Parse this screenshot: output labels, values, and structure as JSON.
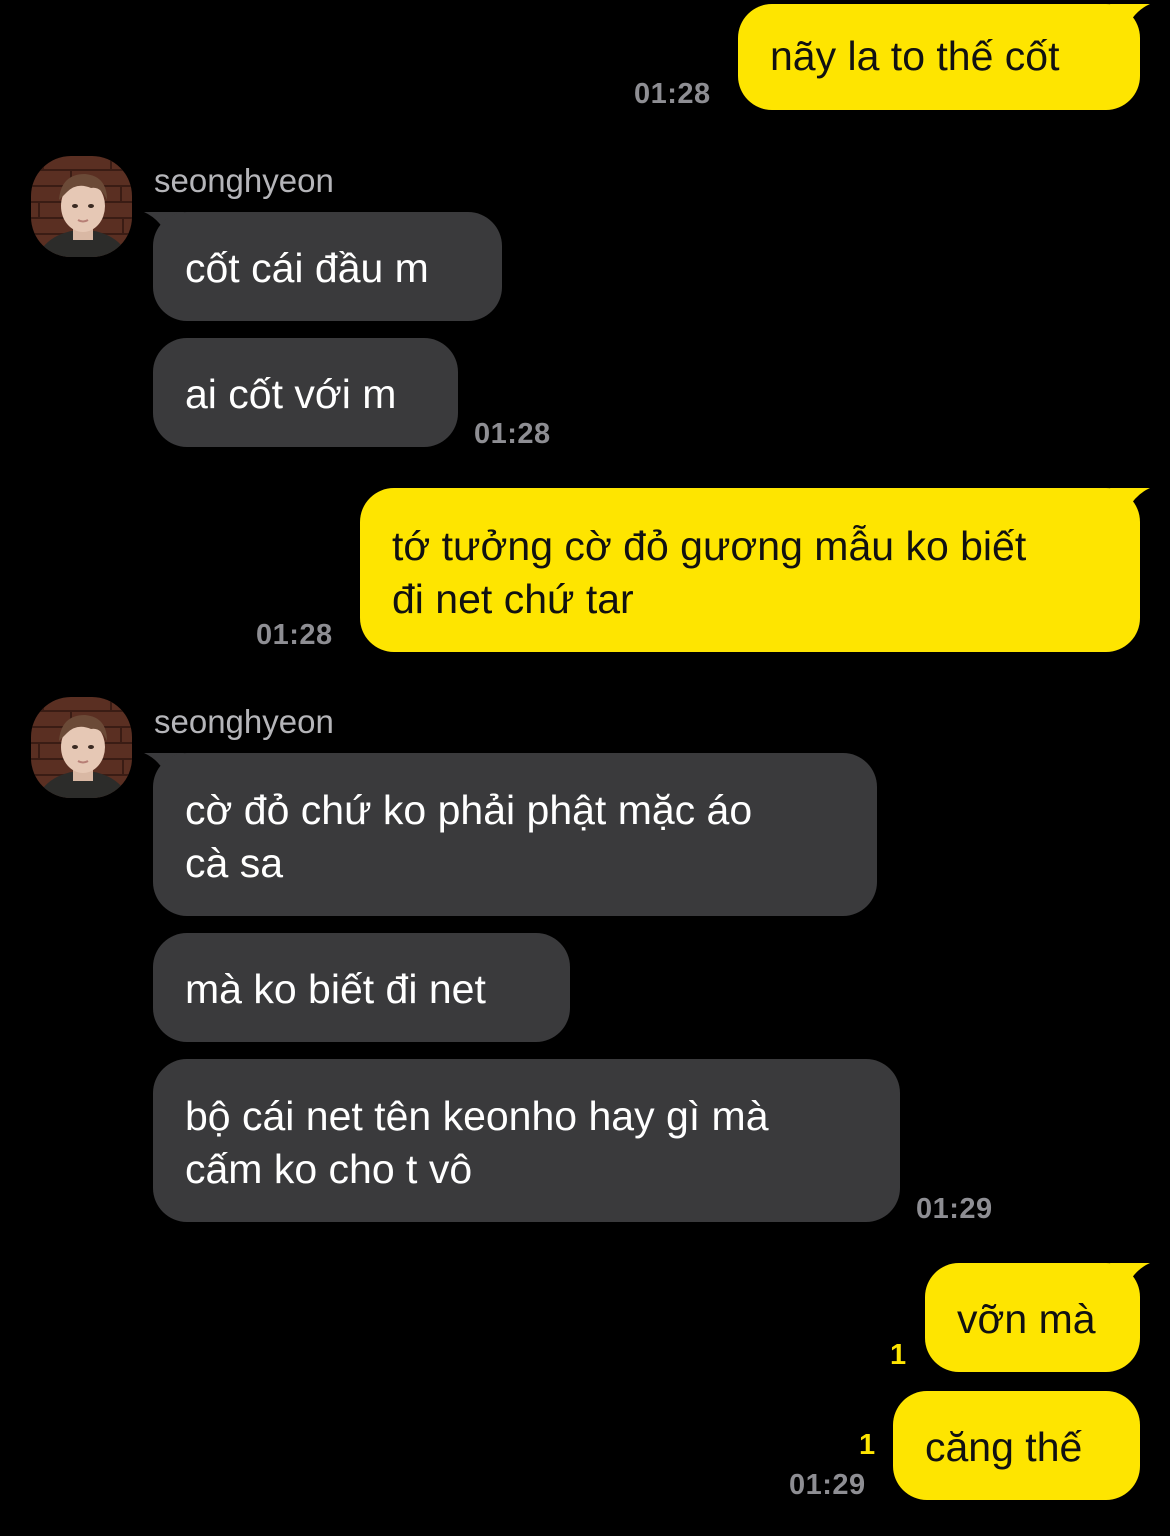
{
  "chat": {
    "contact_name": "seonghyeon",
    "messages": [
      {
        "id": "m1",
        "direction": "outgoing",
        "lines": [
          "nãy la to thế cốt"
        ],
        "time": "01:28"
      },
      {
        "id": "m2",
        "direction": "incoming",
        "sender": "seonghyeon",
        "lines": [
          "cốt cái đầu m"
        ]
      },
      {
        "id": "m3",
        "direction": "incoming",
        "lines": [
          "ai cốt với m"
        ],
        "time": "01:28"
      },
      {
        "id": "m4",
        "direction": "outgoing",
        "lines": [
          "tớ tưởng cờ đỏ gương mẫu ko biết",
          "đi net chứ tar"
        ],
        "time": "01:28"
      },
      {
        "id": "m5",
        "direction": "incoming",
        "sender": "seonghyeon",
        "lines": [
          "cờ đỏ chứ ko phải phật mặc áo",
          "cà sa"
        ]
      },
      {
        "id": "m6",
        "direction": "incoming",
        "lines": [
          "mà ko biết đi net"
        ]
      },
      {
        "id": "m7",
        "direction": "incoming",
        "lines": [
          "bộ cái net tên keonho hay gì mà",
          "cấm ko cho t vô"
        ],
        "time": "01:29"
      },
      {
        "id": "m8",
        "direction": "outgoing",
        "lines": [
          "vỡn mà"
        ],
        "unread": "1"
      },
      {
        "id": "m9",
        "direction": "outgoing",
        "lines": [
          "căng thế"
        ],
        "unread": "1",
        "time": "01:29"
      }
    ]
  },
  "colors": {
    "background": "#000000",
    "outgoing_bubble": "#FEE500",
    "incoming_bubble": "#3A3A3C",
    "timestamp": "#8E8E93",
    "unread_count": "#FEE500"
  }
}
